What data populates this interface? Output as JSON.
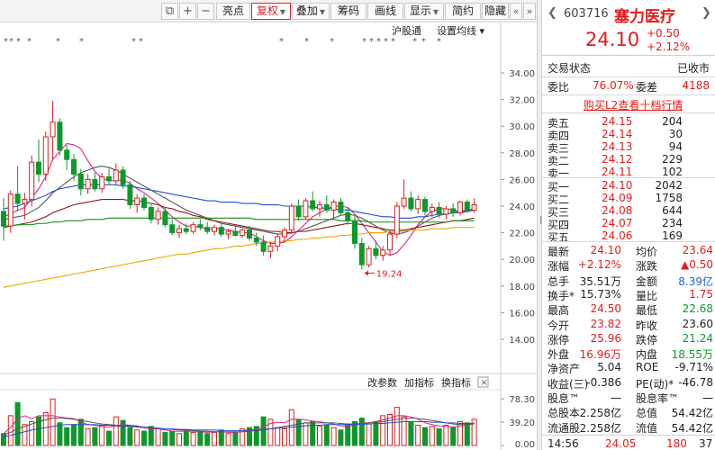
{
  "toolbar": {
    "buttons": [
      "亮点",
      "复权",
      "叠加",
      "筹码",
      "画线",
      "显示",
      "简约",
      "隐藏"
    ],
    "icons": [
      "copy-icon",
      "plus-icon",
      "minus-icon"
    ],
    "nav": [
      "«",
      "»"
    ]
  },
  "chart_labels": {
    "hgt": "沪股通",
    "ma_settings": "设置均线",
    "low_marker": "19.24",
    "vol_buttons": [
      "改参数",
      "加指标",
      "换指标"
    ],
    "star": "*"
  },
  "chart_data": {
    "type": "candlestick",
    "price_ylim": [
      13,
      35
    ],
    "price_ticks": [
      "34.00",
      "32.00",
      "30.00",
      "28.00",
      "26.00",
      "24.00",
      "22.00",
      "20.00",
      "18.00",
      "16.00",
      "14.00"
    ],
    "volume_ticks": [
      "78.30",
      "39.20",
      "0.00"
    ],
    "volume_ylim": [
      0,
      86
    ],
    "low_point": 19.24,
    "candles": [
      [
        23.6,
        24.6,
        21.4,
        22.5
      ],
      [
        22.5,
        25.2,
        22.0,
        24.9
      ],
      [
        24.9,
        27.0,
        23.6,
        24.2
      ],
      [
        24.2,
        25.0,
        23.0,
        24.5
      ],
      [
        24.5,
        27.8,
        24.0,
        27.3
      ],
      [
        27.3,
        29.0,
        25.8,
        26.4
      ],
      [
        26.4,
        29.6,
        25.9,
        29.2
      ],
      [
        29.2,
        31.9,
        27.4,
        30.3
      ],
      [
        30.3,
        30.6,
        27.8,
        28.2
      ],
      [
        28.2,
        28.6,
        26.7,
        27.5
      ],
      [
        27.5,
        27.9,
        25.9,
        26.4
      ],
      [
        26.4,
        26.8,
        24.8,
        25.3
      ],
      [
        25.3,
        26.4,
        24.9,
        26.0
      ],
      [
        26.0,
        26.5,
        25.1,
        25.3
      ],
      [
        25.3,
        26.5,
        25.0,
        26.2
      ],
      [
        26.2,
        26.8,
        25.6,
        25.9
      ],
      [
        25.9,
        27.2,
        25.6,
        26.7
      ],
      [
        26.7,
        27.0,
        25.3,
        25.6
      ],
      [
        25.6,
        25.9,
        23.8,
        24.1
      ],
      [
        24.1,
        24.9,
        23.5,
        24.6
      ],
      [
        24.6,
        24.9,
        23.7,
        23.9
      ],
      [
        23.9,
        24.1,
        22.7,
        23.0
      ],
      [
        23.0,
        23.9,
        22.6,
        23.6
      ],
      [
        23.6,
        23.9,
        22.4,
        22.6
      ],
      [
        22.6,
        23.0,
        21.8,
        22.0
      ],
      [
        22.0,
        22.6,
        21.6,
        22.3
      ],
      [
        22.3,
        22.7,
        21.9,
        22.1
      ],
      [
        22.1,
        22.8,
        21.9,
        22.6
      ],
      [
        22.6,
        23.0,
        22.2,
        22.4
      ],
      [
        22.4,
        22.8,
        21.9,
        22.1
      ],
      [
        22.1,
        22.6,
        21.8,
        22.4
      ],
      [
        22.4,
        22.7,
        21.7,
        21.9
      ],
      [
        21.9,
        22.3,
        21.5,
        22.1
      ],
      [
        22.1,
        22.5,
        21.7,
        21.8
      ],
      [
        21.8,
        22.3,
        21.6,
        22.2
      ],
      [
        22.2,
        22.5,
        21.4,
        21.6
      ],
      [
        21.6,
        22.0,
        21.0,
        21.3
      ],
      [
        21.3,
        21.8,
        20.3,
        20.6
      ],
      [
        20.6,
        21.3,
        20.1,
        21.0
      ],
      [
        21.0,
        21.9,
        20.6,
        21.7
      ],
      [
        21.7,
        22.4,
        21.3,
        22.2
      ],
      [
        22.2,
        24.2,
        21.9,
        24.0
      ],
      [
        24.0,
        24.5,
        22.9,
        23.2
      ],
      [
        23.2,
        24.6,
        23.0,
        24.4
      ],
      [
        24.4,
        25.1,
        23.6,
        23.8
      ],
      [
        23.8,
        24.4,
        23.2,
        24.1
      ],
      [
        24.1,
        24.8,
        23.5,
        23.7
      ],
      [
        23.7,
        24.5,
        23.1,
        24.3
      ],
      [
        24.3,
        24.6,
        23.3,
        23.5
      ],
      [
        23.5,
        23.9,
        22.6,
        22.9
      ],
      [
        22.9,
        23.3,
        20.8,
        21.2
      ],
      [
        21.2,
        21.6,
        19.24,
        19.6
      ],
      [
        19.6,
        21.0,
        19.4,
        20.8
      ],
      [
        20.8,
        21.4,
        20.0,
        20.3
      ],
      [
        20.3,
        21.0,
        19.9,
        20.7
      ],
      [
        20.7,
        22.2,
        20.3,
        21.9
      ],
      [
        21.9,
        24.3,
        21.6,
        24.0
      ],
      [
        24.0,
        26.0,
        23.8,
        24.6
      ],
      [
        24.6,
        25.1,
        23.6,
        23.8
      ],
      [
        23.8,
        24.8,
        23.4,
        24.5
      ],
      [
        24.5,
        24.7,
        23.3,
        23.6
      ],
      [
        23.6,
        24.2,
        23.2,
        23.9
      ],
      [
        23.9,
        24.3,
        23.1,
        23.4
      ],
      [
        23.4,
        24.0,
        23.0,
        23.8
      ],
      [
        23.8,
        24.2,
        23.2,
        23.5
      ],
      [
        23.5,
        24.4,
        23.3,
        24.3
      ],
      [
        24.3,
        24.5,
        23.5,
        23.7
      ],
      [
        23.7,
        24.6,
        23.5,
        24.1
      ]
    ],
    "volumes": [
      20,
      50,
      72,
      35,
      40,
      48,
      55,
      78,
      38,
      30,
      35,
      44,
      28,
      30,
      34,
      24,
      48,
      42,
      30,
      26,
      24,
      32,
      28,
      22,
      24,
      20,
      26,
      22,
      24,
      20,
      22,
      26,
      20,
      22,
      28,
      30,
      32,
      48,
      44,
      30,
      28,
      60,
      44,
      38,
      40,
      32,
      34,
      30,
      26,
      36,
      40,
      46,
      36,
      40,
      50,
      52,
      64,
      48,
      40,
      34,
      30,
      32,
      28,
      34,
      30,
      40,
      38,
      44
    ],
    "ma": [
      {
        "color": "#e0218a",
        "values": [
          23.2,
          23.4,
          23.7,
          23.9,
          24.6,
          25.3,
          26.2,
          27.5,
          28.1,
          28.7,
          28.6,
          28.3,
          27.4,
          26.6,
          26.1,
          25.9,
          25.9,
          26.0,
          25.7,
          25.3,
          25.0,
          24.6,
          24.2,
          23.7,
          23.2,
          22.8,
          22.5,
          22.5,
          22.4,
          22.3,
          22.3,
          22.3,
          22.2,
          22.1,
          22.0,
          22.0,
          21.7,
          21.4,
          21.2,
          21.2,
          21.3,
          21.7,
          22.2,
          22.7,
          23.2,
          23.5,
          23.8,
          24.0,
          24.0,
          23.9,
          23.4,
          22.7,
          22.0,
          21.3,
          20.6,
          20.3,
          20.5,
          21.1,
          21.8,
          22.6,
          23.2,
          23.6,
          23.8,
          23.8,
          23.7,
          23.6,
          23.7,
          23.8
        ]
      },
      {
        "color": "#555555",
        "values": [
          23.0,
          23.1,
          23.2,
          23.3,
          23.6,
          23.9,
          24.4,
          25.0,
          25.4,
          25.8,
          26.2,
          26.5,
          26.7,
          26.9,
          27.0,
          26.9,
          26.7,
          26.4,
          26.1,
          25.8,
          25.5,
          25.2,
          24.9,
          24.6,
          24.3,
          24.0,
          23.7,
          23.5,
          23.3,
          23.1,
          22.9,
          22.7,
          22.6,
          22.5,
          22.4,
          22.3,
          22.2,
          22.1,
          22.0,
          21.9,
          21.9,
          22.0,
          22.1,
          22.3,
          22.5,
          22.7,
          22.9,
          23.1,
          23.3,
          23.4,
          23.3,
          23.1,
          22.8,
          22.5,
          22.2,
          22.0,
          21.9,
          22.0,
          22.2,
          22.5,
          22.8,
          23.1,
          23.3,
          23.4,
          23.5,
          23.5,
          23.6,
          23.7
        ]
      },
      {
        "color": "#8b1a1a",
        "values": [
          22.4,
          22.5,
          22.6,
          22.7,
          22.8,
          23.0,
          23.2,
          23.5,
          23.7,
          23.9,
          24.1,
          24.2,
          24.3,
          24.4,
          24.5,
          24.5,
          24.5,
          24.5,
          24.4,
          24.4,
          24.3,
          24.2,
          24.1,
          23.9,
          23.8,
          23.6,
          23.5,
          23.3,
          23.2,
          23.0,
          22.9,
          22.8,
          22.7,
          22.6,
          22.5,
          22.4,
          22.3,
          22.2,
          22.1,
          22.1,
          22.0,
          22.0,
          22.1,
          22.1,
          22.2,
          22.3,
          22.4,
          22.5,
          22.6,
          22.7,
          22.7,
          22.6,
          22.5,
          22.4,
          22.3,
          22.2,
          22.2,
          22.2,
          22.3,
          22.4,
          22.5,
          22.6,
          22.7,
          22.8,
          22.9,
          22.9,
          23.0,
          23.1
        ]
      },
      {
        "color": "#1f4fd0",
        "values": [
          23.8,
          23.9,
          24.0,
          24.2,
          24.4,
          24.6,
          24.8,
          25.1,
          25.3,
          25.4,
          25.5,
          25.6,
          25.6,
          25.6,
          25.6,
          25.6,
          25.6,
          25.5,
          25.5,
          25.4,
          25.3,
          25.2,
          25.1,
          25.0,
          24.9,
          24.8,
          24.7,
          24.6,
          24.5,
          24.4,
          24.4,
          24.3,
          24.3,
          24.3,
          24.2,
          24.2,
          24.2,
          24.1,
          24.1,
          24.1,
          24.0,
          24.0,
          24.0,
          24.0,
          23.9,
          23.9,
          23.8,
          23.8,
          23.7,
          23.7,
          23.6,
          23.5,
          23.4,
          23.3,
          23.2,
          23.2,
          23.1,
          23.1,
          23.1,
          23.2,
          23.2,
          23.3,
          23.4,
          23.4,
          23.5,
          23.6,
          23.6,
          23.7
        ]
      },
      {
        "color": "#178a1a",
        "values": [
          22.5,
          22.5,
          22.6,
          22.6,
          22.6,
          22.7,
          22.7,
          22.8,
          22.8,
          22.9,
          22.9,
          22.9,
          23.0,
          23.0,
          23.0,
          23.1,
          23.1,
          23.1,
          23.1,
          23.1,
          23.1,
          23.1,
          23.1,
          23.1,
          23.1,
          23.1,
          23.1,
          23.1,
          23.1,
          23.1,
          23.1,
          23.1,
          23.1,
          23.1,
          23.1,
          23.1,
          23.0,
          23.0,
          23.0,
          23.0,
          23.0,
          23.0,
          23.0,
          23.0,
          23.0,
          23.0,
          23.0,
          23.0,
          22.9,
          22.9,
          22.9,
          22.9,
          22.8,
          22.8,
          22.8,
          22.8,
          22.8,
          22.8,
          22.8,
          22.8,
          22.8,
          22.8,
          22.8,
          22.8,
          22.9,
          22.9,
          22.9,
          22.9
        ]
      },
      {
        "color": "#f0a500",
        "values": [
          17.9,
          18.0,
          18.1,
          18.2,
          18.3,
          18.4,
          18.5,
          18.6,
          18.7,
          18.8,
          18.9,
          19.0,
          19.1,
          19.2,
          19.3,
          19.4,
          19.5,
          19.6,
          19.7,
          19.8,
          19.9,
          20.0,
          20.1,
          20.2,
          20.3,
          20.4,
          20.4,
          20.5,
          20.6,
          20.7,
          20.8,
          20.8,
          20.9,
          21.0,
          21.0,
          21.1,
          21.2,
          21.2,
          21.3,
          21.3,
          21.4,
          21.4,
          21.5,
          21.5,
          21.6,
          21.6,
          21.7,
          21.7,
          21.8,
          21.8,
          21.9,
          21.9,
          22.0,
          22.0,
          22.0,
          22.1,
          22.1,
          22.1,
          22.2,
          22.2,
          22.2,
          22.3,
          22.3,
          22.3,
          22.4,
          22.4,
          22.4,
          22.4
        ]
      }
    ],
    "vol_ma": [
      {
        "color": "#e0218a",
        "values": [
          20,
          30,
          45,
          50,
          45,
          50,
          50,
          50,
          48,
          46,
          45,
          40,
          35,
          34,
          32,
          31,
          33,
          35,
          34,
          33,
          30,
          28,
          28,
          26,
          24,
          24,
          24,
          24,
          23,
          22,
          23,
          23,
          22,
          22,
          23,
          25,
          27,
          31,
          37,
          39,
          38,
          44,
          44,
          43,
          41,
          40,
          38,
          36,
          33,
          32,
          34,
          38,
          38,
          40,
          43,
          46,
          50,
          50,
          48,
          44,
          38,
          35,
          33,
          32,
          31,
          33,
          34,
          38
        ]
      },
      {
        "color": "#555555",
        "values": [
          18,
          22,
          28,
          32,
          36,
          40,
          43,
          46,
          46,
          45,
          44,
          42,
          40,
          38,
          36,
          35,
          34,
          34,
          33,
          32,
          31,
          30,
          29,
          28,
          27,
          26,
          26,
          25,
          24,
          24,
          23,
          23,
          23,
          23,
          23,
          24,
          25,
          26,
          28,
          30,
          32,
          34,
          36,
          38,
          38,
          38,
          38,
          38,
          37,
          36,
          36,
          37,
          38,
          39,
          40,
          42,
          44,
          45,
          46,
          45,
          44,
          42,
          40,
          38,
          36,
          35,
          35,
          36
        ]
      },
      {
        "color": "#1f4fd0",
        "values": [
          15,
          17,
          20,
          23,
          26,
          28,
          30,
          32,
          34,
          35,
          35,
          35,
          35,
          35,
          34,
          34,
          33,
          32,
          32,
          31,
          30,
          30,
          29,
          28,
          28,
          27,
          27,
          26,
          26,
          26,
          26,
          25,
          25,
          25,
          25,
          26,
          26,
          27,
          28,
          29,
          30,
          31,
          32,
          33,
          34,
          34,
          35,
          35,
          35,
          35,
          35,
          36,
          36,
          37,
          37,
          38,
          39,
          40,
          40,
          40,
          40,
          39,
          39,
          38,
          38,
          37,
          37,
          37
        ]
      }
    ]
  },
  "panel": {
    "code": "603716",
    "name": "塞力医疗",
    "price": "24.10",
    "change": "+0.50",
    "change_pct": "+2.12%",
    "status_label": "交易状态",
    "status_value": "已收市",
    "wb_label": "委比",
    "wb_value": "76.07%",
    "wc_label": "委差",
    "wc_value": "4188",
    "l2_link": "购买L2查看十档行情",
    "asks": [
      {
        "label": "卖五",
        "price": "24.15",
        "vol": "204"
      },
      {
        "label": "卖四",
        "price": "24.14",
        "vol": "30"
      },
      {
        "label": "卖三",
        "price": "24.13",
        "vol": "94"
      },
      {
        "label": "卖二",
        "price": "24.12",
        "vol": "229"
      },
      {
        "label": "卖一",
        "price": "24.11",
        "vol": "102"
      }
    ],
    "bids": [
      {
        "label": "买一",
        "price": "24.10",
        "vol": "2042"
      },
      {
        "label": "买二",
        "price": "24.09",
        "vol": "1758"
      },
      {
        "label": "买三",
        "price": "24.08",
        "vol": "644"
      },
      {
        "label": "买四",
        "price": "24.07",
        "vol": "234"
      },
      {
        "label": "买五",
        "price": "24.06",
        "vol": "169"
      }
    ],
    "stats": [
      {
        "l1": "最新",
        "v1": "24.10",
        "c1": "red",
        "l2": "均价",
        "v2": "23.64",
        "c2": "red"
      },
      {
        "l1": "涨幅",
        "v1": "+2.12%",
        "c1": "red",
        "l2": "涨跌",
        "v2": "▲0.50",
        "c2": "red"
      },
      {
        "l1": "总手",
        "v1": "35.51万",
        "c1": "dark",
        "l2": "金额",
        "v2": "8.39亿",
        "c2": "blue"
      },
      {
        "l1": "换手*",
        "v1": "15.73%",
        "c1": "dark",
        "l2": "量比",
        "v2": "1.75",
        "c2": "red"
      },
      {
        "l1": "最高",
        "v1": "24.50",
        "c1": "red",
        "l2": "最低",
        "v2": "22.68",
        "c2": "green"
      },
      {
        "l1": "今开",
        "v1": "23.82",
        "c1": "red",
        "l2": "昨收",
        "v2": "23.60",
        "c2": "dark"
      },
      {
        "l1": "涨停",
        "v1": "25.96",
        "c1": "red",
        "l2": "跌停",
        "v2": "21.24",
        "c2": "green"
      },
      {
        "l1": "外盘",
        "v1": "16.96万",
        "c1": "red",
        "l2": "内盘",
        "v2": "18.55万",
        "c2": "green"
      },
      {
        "l1": "净资产",
        "v1": "5.04",
        "c1": "dark",
        "l2": "ROE",
        "v2": "-9.71%",
        "c2": "dark"
      },
      {
        "l1": "收益(三)",
        "v1": "-0.386",
        "c1": "dark",
        "l2": "PE(动)*",
        "v2": "-46.78",
        "c2": "dark"
      },
      {
        "l1": "股息™",
        "v1": "一",
        "c1": "dark",
        "l2": "股息率™",
        "v2": "一",
        "c2": "dark"
      },
      {
        "l1": "总股本",
        "v1": "2.258亿",
        "c1": "dark",
        "l2": "总值",
        "v2": "54.42亿",
        "c2": "dark"
      },
      {
        "l1": "流通股",
        "v1": "2.258亿",
        "c1": "dark",
        "l2": "流值",
        "v2": "54.42亿",
        "c2": "dark"
      }
    ],
    "bottom": {
      "time": "14:56",
      "price": "24.05",
      "vol": "180",
      "count": "37"
    }
  }
}
